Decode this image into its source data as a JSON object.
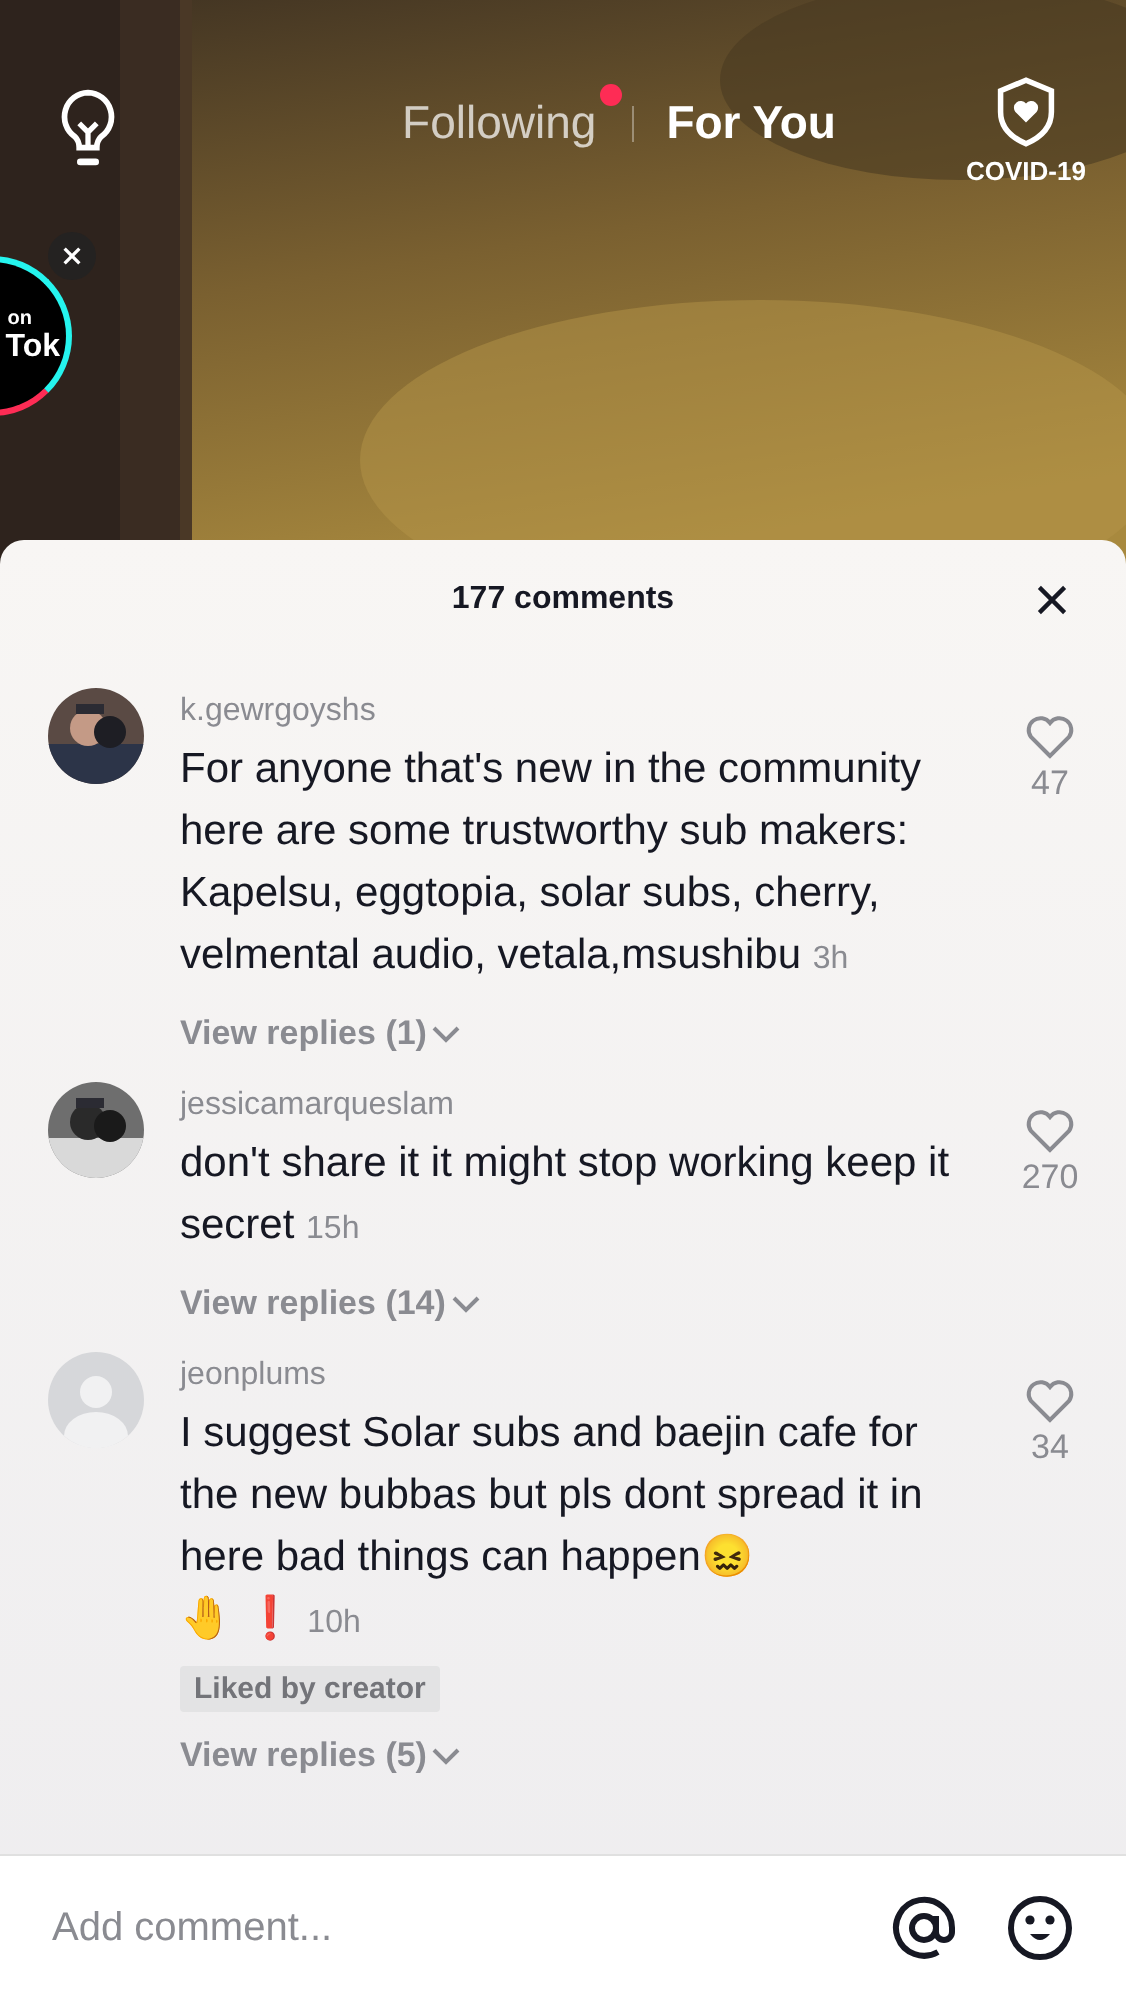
{
  "top_bar": {
    "tabs": [
      {
        "label": "Following",
        "selected": false,
        "notification_dot": true
      },
      {
        "label": "For You",
        "selected": true,
        "notification_dot": false
      }
    ],
    "covid_label": "COVID-19"
  },
  "live_badge": {
    "line_1": "on",
    "line_2": "Tok"
  },
  "comments_panel": {
    "title": "177 comments",
    "comments": [
      {
        "username": "k.gewrgoyshs",
        "text": "For anyone that's new in the community here are some trustworthy sub makers: Kapelsu, eggtopia, solar subs, cherry, velmental audio, vetala,msushibu",
        "time": "3h",
        "likes": "47",
        "replies": "View replies (1)"
      },
      {
        "username": "jessicamarqueslam",
        "text": "don't share it it might stop working keep it secret",
        "time": "15h",
        "likes": "270",
        "replies": "View replies (14)"
      },
      {
        "avatar": {
          "kind": "default"
        },
        "username": "jeonplums",
        "text": "I suggest Solar subs and baejin cafe for the new bubbas but pls dont spread it in here bad things can happen😖\n🤚 ❗",
        "time": "10h",
        "likes": "34",
        "tag": "Liked by creator",
        "replies": "View replies (5)"
      }
    ]
  },
  "composer": {
    "placeholder": "Add comment..."
  }
}
